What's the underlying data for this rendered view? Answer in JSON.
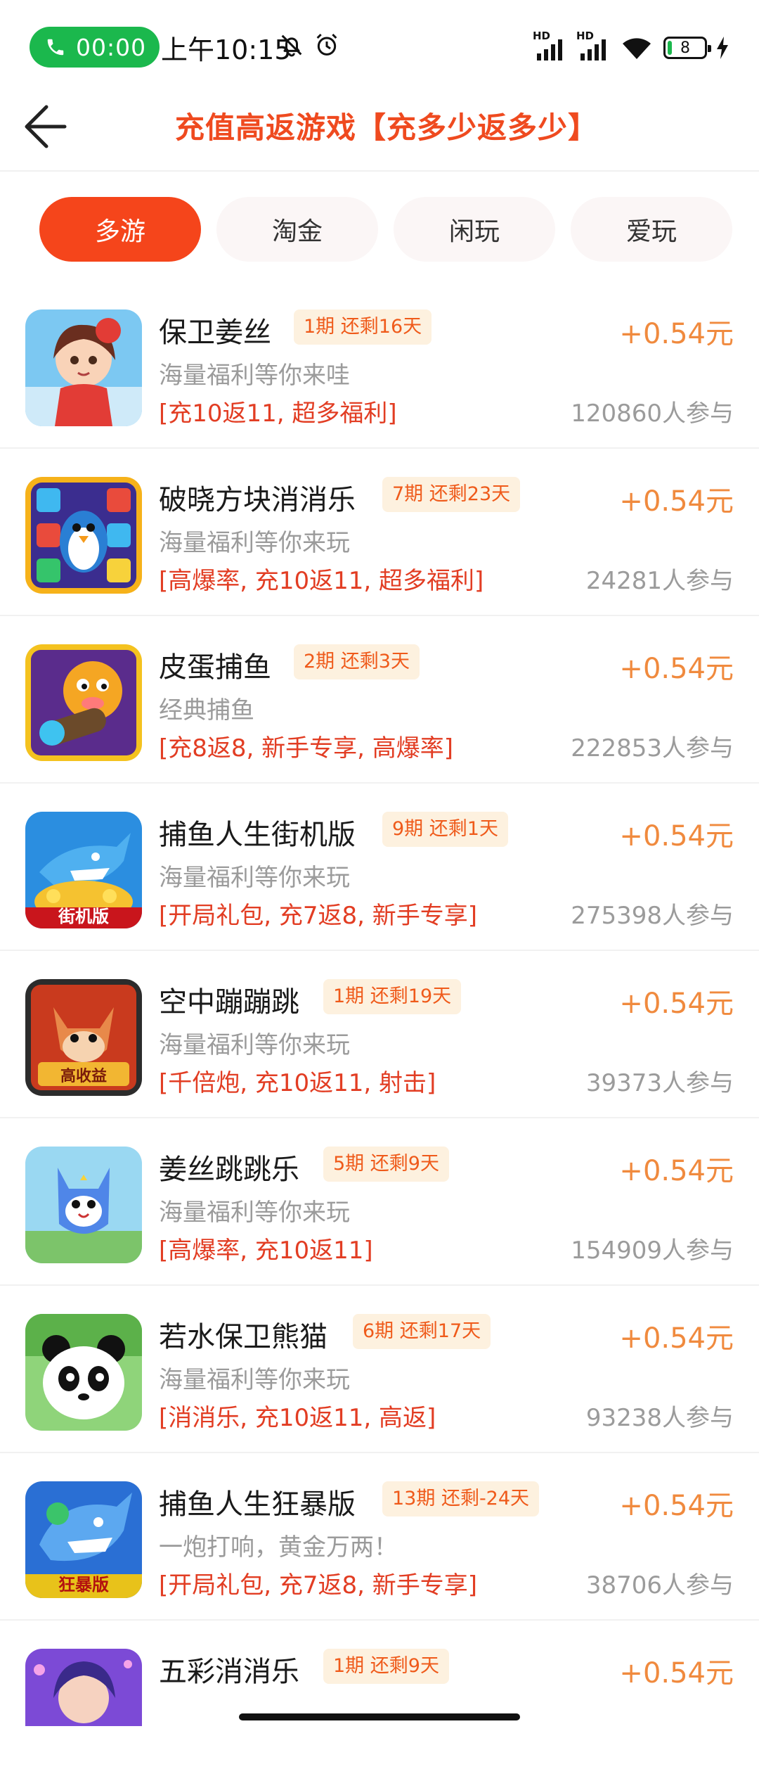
{
  "status_bar": {
    "call_timer": "00:00",
    "time": "上午10:15",
    "signal_label_1": "HD",
    "signal_label_2": "HD",
    "battery_level": "8",
    "call_pill_color": "#1bb84d"
  },
  "header": {
    "title": "充值高返游戏【充多少返多少】",
    "title_color": "#ef4a1f"
  },
  "tabs": [
    {
      "label": "多游",
      "active": true
    },
    {
      "label": "淘金",
      "active": false
    },
    {
      "label": "闲玩",
      "active": false
    },
    {
      "label": "爱玩",
      "active": false
    }
  ],
  "games": [
    {
      "name": "保卫姜丝",
      "badge": "1期 还剩16天",
      "desc": "海量福利等你来哇",
      "tags": "[充10返11, 超多福利]",
      "reward": "+0.54元",
      "participants": "120860人参与",
      "icon": "girl-character-icon"
    },
    {
      "name": "破晓方块消消乐",
      "badge": "7期 还剩23天",
      "desc": "海量福利等你来玩",
      "tags": "[高爆率, 充10返11, 超多福利]",
      "reward": "+0.54元",
      "participants": "24281人参与",
      "icon": "penguin-blocks-icon"
    },
    {
      "name": "皮蛋捕鱼",
      "badge": "2期 还剩3天",
      "desc": "经典捕鱼",
      "tags": "[充8返8, 新手专享, 高爆率]",
      "reward": "+0.54元",
      "participants": "222853人参与",
      "icon": "cannon-creature-icon"
    },
    {
      "name": "捕鱼人生街机版",
      "badge": "9期 还剩1天",
      "desc": "海量福利等你来玩",
      "tags": "[开局礼包, 充7返8, 新手专享]",
      "reward": "+0.54元",
      "participants": "275398人参与",
      "icon": "shark-arcade-icon",
      "icon_caption": "街机版"
    },
    {
      "name": "空中蹦蹦跳",
      "badge": "1期 还剩19天",
      "desc": "海量福利等你来玩",
      "tags": "[千倍炮, 充10返11, 射击]",
      "reward": "+0.54元",
      "participants": "39373人参与",
      "icon": "fox-pilot-icon",
      "icon_caption": "高收益"
    },
    {
      "name": "姜丝跳跳乐",
      "badge": "5期 还剩9天",
      "desc": "海量福利等你来玩",
      "tags": "[高爆率, 充10返11]",
      "reward": "+0.54元",
      "participants": "154909人参与",
      "icon": "blue-creature-icon"
    },
    {
      "name": "若水保卫熊猫",
      "badge": "6期 还剩17天",
      "desc": "海量福利等你来玩",
      "tags": "[消消乐, 充10返11, 高返]",
      "reward": "+0.54元",
      "participants": "93238人参与",
      "icon": "panda-icon"
    },
    {
      "name": "捕鱼人生狂暴版",
      "badge": "13期 还剩-24天",
      "desc": "一炮打响，黄金万两！",
      "tags": "[开局礼包, 充7返8, 新手专享]",
      "reward": "+0.54元",
      "participants": "38706人参与",
      "icon": "shark-rage-icon",
      "icon_caption": "狂暴版"
    },
    {
      "name": "五彩消消乐",
      "badge": "1期 还剩9天",
      "desc": "",
      "tags": "",
      "reward": "+0.54元",
      "participants": "",
      "icon": "fairy-icon"
    }
  ]
}
